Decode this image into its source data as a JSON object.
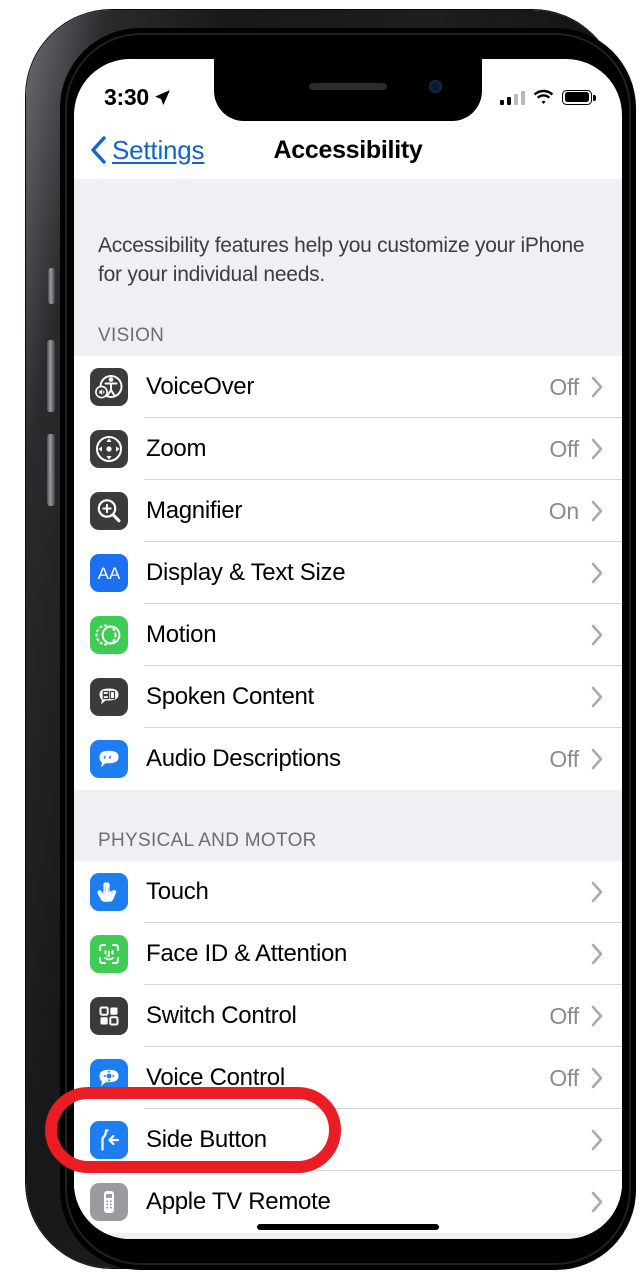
{
  "status_bar": {
    "time": "3:30",
    "location_icon": "location-arrow-icon",
    "cellular_icon": "cellular-signal-icon",
    "wifi_icon": "wifi-icon",
    "battery_icon": "battery-full-icon"
  },
  "nav": {
    "back_label": "Settings",
    "title": "Accessibility",
    "back_icon": "chevron-left-icon",
    "accent_color": "#0f64d2"
  },
  "intro": {
    "text": "Accessibility features help you customize your iPhone for your individual needs."
  },
  "sections": [
    {
      "header": "VISION",
      "rows": [
        {
          "label": "VoiceOver",
          "value": "Off",
          "icon": "voiceover-icon",
          "icon_color": "#3b3b3d"
        },
        {
          "label": "Zoom",
          "value": "Off",
          "icon": "zoom-icon",
          "icon_color": "#3b3b3d"
        },
        {
          "label": "Magnifier",
          "value": "On",
          "icon": "magnifier-icon",
          "icon_color": "#3b3b3d"
        },
        {
          "label": "Display & Text Size",
          "value": "",
          "icon": "display-text-size-icon",
          "icon_color": "#1d6ff2"
        },
        {
          "label": "Motion",
          "value": "",
          "icon": "motion-icon",
          "icon_color": "#3fcc55"
        },
        {
          "label": "Spoken Content",
          "value": "",
          "icon": "spoken-content-icon",
          "icon_color": "#3b3b3d"
        },
        {
          "label": "Audio Descriptions",
          "value": "Off",
          "icon": "audio-descriptions-icon",
          "icon_color": "#1d7ef2"
        }
      ]
    },
    {
      "header": "PHYSICAL AND MOTOR",
      "rows": [
        {
          "label": "Touch",
          "value": "",
          "icon": "touch-icon",
          "icon_color": "#1d7ef2"
        },
        {
          "label": "Face ID & Attention",
          "value": "",
          "icon": "face-id-icon",
          "icon_color": "#3fcc55"
        },
        {
          "label": "Switch Control",
          "value": "Off",
          "icon": "switch-control-icon",
          "icon_color": "#3b3b3d"
        },
        {
          "label": "Voice Control",
          "value": "Off",
          "icon": "voice-control-icon",
          "icon_color": "#1d7ef2"
        },
        {
          "label": "Side Button",
          "value": "",
          "icon": "side-button-icon",
          "icon_color": "#1d7ef2"
        },
        {
          "label": "Apple TV Remote",
          "value": "",
          "icon": "apple-tv-remote-icon",
          "icon_color": "#9a9a9f"
        }
      ]
    }
  ],
  "annotation": {
    "target_label": "Side Button",
    "color": "#ec1c24",
    "shape": "oval-highlight"
  }
}
